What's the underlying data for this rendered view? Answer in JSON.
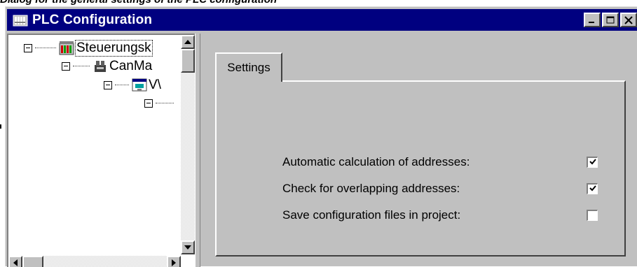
{
  "caption": "Dialog for the general settings of the PLC configuration",
  "window": {
    "title": "PLC Configuration",
    "title_icon": "plc-grid-icon",
    "buttons": [
      "minimize-icon",
      "maximize-icon",
      "close-icon"
    ]
  },
  "tree": {
    "nodes": [
      {
        "label": "Steuerungsk",
        "icon": "plc-device-icon",
        "expanded": true,
        "selected": true
      },
      {
        "label": "CanMa",
        "icon": "can-master-icon",
        "expanded": true
      },
      {
        "label": "V\\",
        "icon": "module-window-icon",
        "expanded": true
      },
      {
        "label": "",
        "icon": "",
        "expanded": true
      }
    ]
  },
  "tabs": [
    {
      "label": "Settings",
      "active": true
    }
  ],
  "settings": [
    {
      "label": "Automatic calculation of addresses:",
      "checked": true
    },
    {
      "label": "Check for overlapping addresses:",
      "checked": true
    },
    {
      "label": "Save configuration files in project:",
      "checked": false
    }
  ],
  "colors": {
    "titlebar": "#000080",
    "face": "#c0c0c0",
    "tree_background": "#ffffff"
  }
}
